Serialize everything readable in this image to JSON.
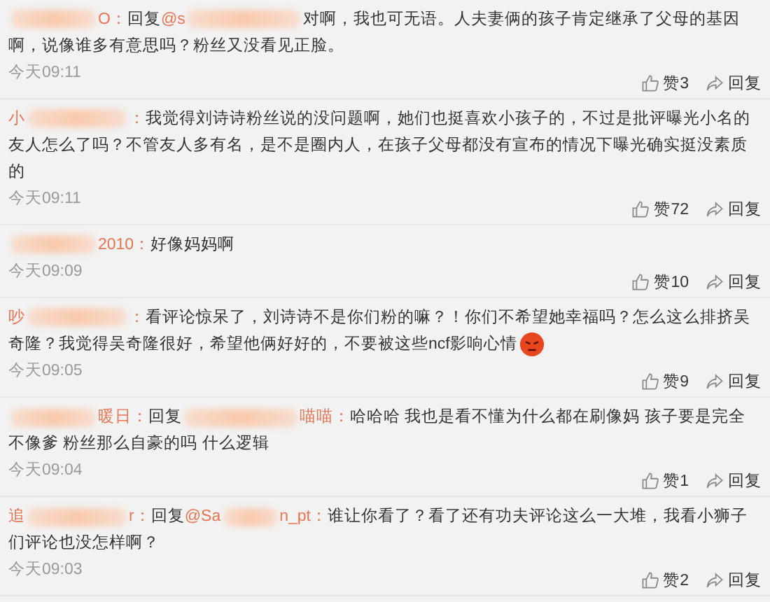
{
  "comments": [
    {
      "author": {
        "tail": "O："
      },
      "reply": {
        "label": "回复",
        "target_head": "@s"
      },
      "text": "对啊，我也可无语。人夫妻俩的孩子肯定继承了父母的基因啊，说像谁多有意思吗？粉丝又没看见正脸。",
      "time": "今天09:11",
      "likes": "赞3",
      "reply_button": "回复"
    },
    {
      "author": {
        "head": "小",
        "tail": "："
      },
      "text": "我觉得刘诗诗粉丝说的没问题啊，她们也挺喜欢小孩子的，不过是批评曝光小名的友人怎么了吗？不管友人多有名，是不是圈内人，在孩子父母都没有宣布的情况下曝光确实挺没素质的",
      "time": "今天09:11",
      "likes": "赞72",
      "reply_button": "回复"
    },
    {
      "author": {
        "tail": "2010："
      },
      "text": "好像妈妈啊",
      "time": "今天09:09",
      "likes": "赞10",
      "reply_button": "回复"
    },
    {
      "author": {
        "head": "吵",
        "tail": "："
      },
      "text": "看评论惊呆了，刘诗诗不是你们粉的嘛？！你们不希望她幸福吗？怎么这么排挤吴奇隆？我觉得吴奇隆很好，希望他俩好好的，不要被这些ncf影响心情",
      "emoji": {
        "kind": "angry"
      },
      "time": "今天09:05",
      "likes": "赞9",
      "reply_button": "回复"
    },
    {
      "author": {
        "tail": "暖日："
      },
      "reply": {
        "label": "回复",
        "target_tail": "喵喵："
      },
      "text": "哈哈哈 我也是看不懂为什么都在刷像妈 孩子要是完全不像爹 粉丝那么自豪的吗 什么逻辑",
      "time": "今天09:04",
      "likes": "赞1",
      "reply_button": "回复"
    },
    {
      "author": {
        "head": "追",
        "tail": "r："
      },
      "reply": {
        "label": "回复",
        "target_head": "@Sa",
        "target_tail": "n_pt："
      },
      "text": "谁让你看了？看了还有功夫评论这么一大堆，我看小狮子们评论也没怎样啊？",
      "time": "今天09:03",
      "likes": "赞2",
      "reply_button": "回复"
    }
  ]
}
